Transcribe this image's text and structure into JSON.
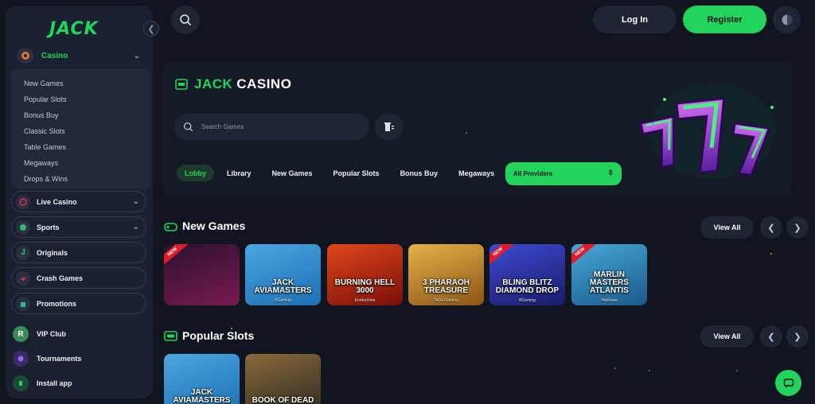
{
  "brand": {
    "logo": "JACK",
    "accent": "#22d35c",
    "bg": "#10151f"
  },
  "sidebar": {
    "casino": {
      "label": "Casino",
      "icon": "chip-icon"
    },
    "casino_sub": [
      "New Games",
      "Popular Slots",
      "Bonus Buy",
      "Classic Slots",
      "Table Games",
      "Megaways",
      "Drops & Wins"
    ],
    "pills": [
      {
        "label": "Live Casino",
        "icon": "roulette-icon",
        "chevron": true
      },
      {
        "label": "Sports",
        "icon": "ball-icon",
        "chevron": true
      },
      {
        "label": "Originals",
        "icon": "jack-j-icon",
        "chevron": false
      },
      {
        "label": "Crash Games",
        "icon": "plane-icon",
        "chevron": false
      },
      {
        "label": "Promotions",
        "icon": "gift-icon",
        "chevron": false
      }
    ],
    "plain": [
      {
        "label": "VIP Club",
        "icon": "vip-icon"
      },
      {
        "label": "Tournaments",
        "icon": "trophy-icon"
      },
      {
        "label": "Install app",
        "icon": "download-icon"
      }
    ]
  },
  "header": {
    "login": "Log In",
    "register": "Register"
  },
  "hero": {
    "title_accent": "JACK",
    "title_rest": "CASINO",
    "search_placeholder": "Search Games",
    "tabs": [
      "Lobby",
      "Library",
      "New Games",
      "Popular Slots",
      "Bonus Buy",
      "Megaways"
    ],
    "active_tab": "Lobby",
    "providers": "All Providers"
  },
  "sections": [
    {
      "title": "New Games",
      "view_all": "View All",
      "games": [
        {
          "name": "",
          "provider": "",
          "new": true,
          "colors": [
            "#2a1130",
            "#7a1a52"
          ]
        },
        {
          "name": "JACK AVIAMASTERS",
          "provider": "BGaming",
          "new": false,
          "colors": [
            "#4aa6e0",
            "#1d6fb4"
          ]
        },
        {
          "name": "BURNING HELL 3000",
          "provider": "Endorphina",
          "new": false,
          "colors": [
            "#e0471a",
            "#7a0f0a"
          ]
        },
        {
          "name": "3 PHARAOH TREASURE",
          "provider": "TaDa Gaming",
          "new": false,
          "colors": [
            "#e6b24a",
            "#8a5414"
          ]
        },
        {
          "name": "BLING BLITZ DIAMOND DROP",
          "provider": "BGaming",
          "new": true,
          "colors": [
            "#3d4ad0",
            "#1a1c6a"
          ]
        },
        {
          "name": "MARLIN MASTERS ATLANTIS",
          "provider": "Hacksaw",
          "new": true,
          "colors": [
            "#46a8d8",
            "#1a5a8a"
          ]
        }
      ]
    },
    {
      "title": "Popular Slots",
      "view_all": "View All",
      "games": [
        {
          "name": "JACK AVIAMASTERS",
          "provider": "",
          "new": false,
          "colors": [
            "#4aa6e0",
            "#1d6fb4"
          ]
        },
        {
          "name": "BOOK OF DEAD",
          "provider": "",
          "new": false,
          "colors": [
            "#8a6a3a",
            "#2e2a22"
          ]
        }
      ]
    }
  ],
  "badge_text": "NEW"
}
